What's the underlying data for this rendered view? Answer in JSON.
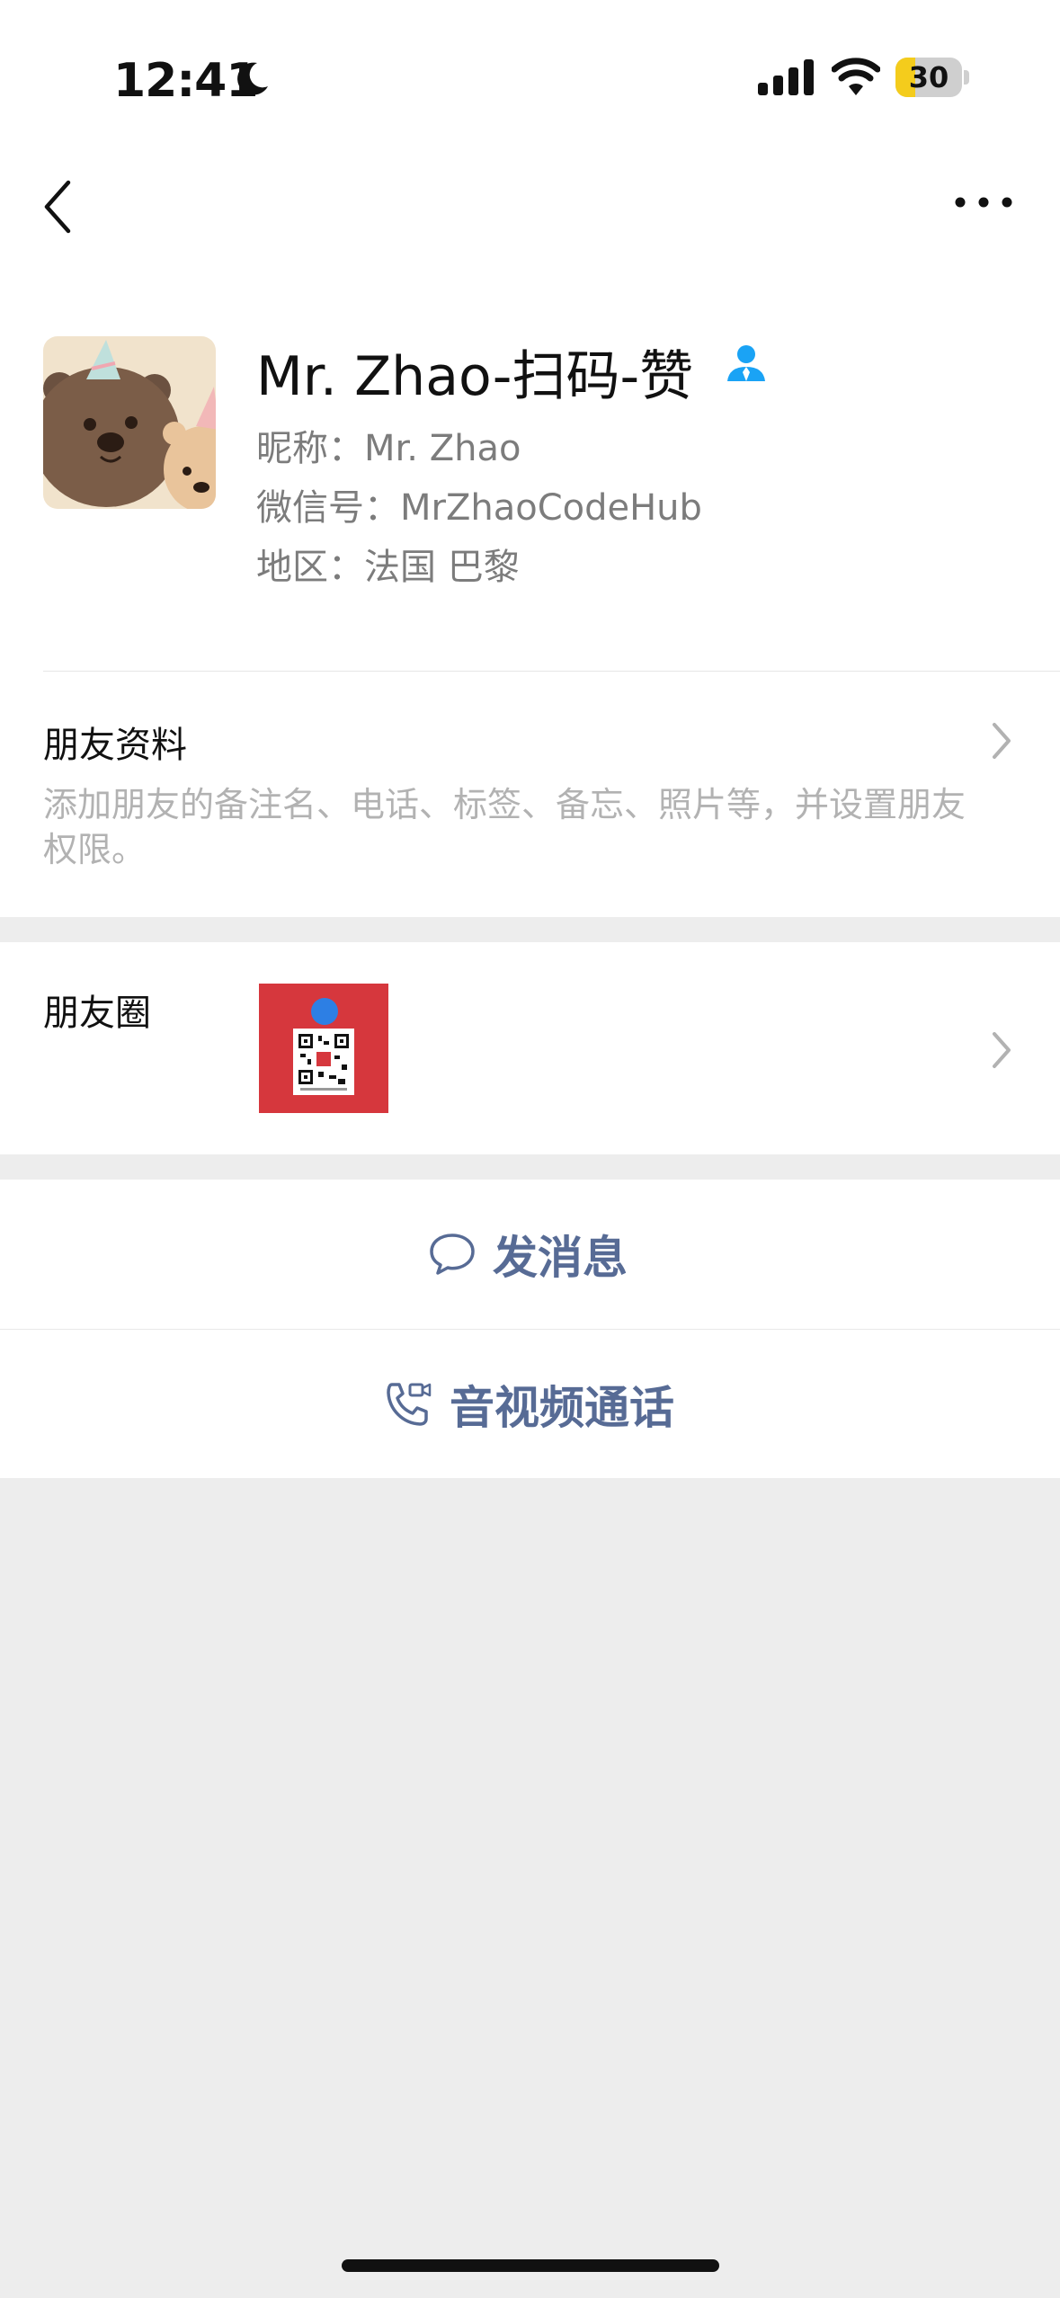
{
  "status_bar": {
    "time": "12:41",
    "battery_level": "30",
    "battery_fraction": 0.3
  },
  "nav": {
    "back_icon": "chevron-left-icon",
    "more_icon": "more-horizontal-icon"
  },
  "profile": {
    "name": "Mr. Zhao-扫码-赞",
    "nickname": "昵称：Mr. Zhao",
    "wechat_id": "微信号：MrZhaoCodeHub",
    "region": "地区：法国 巴黎",
    "accent": "#1aa3f5"
  },
  "friend_info": {
    "title": "朋友资料",
    "description": "添加朋友的备注名、电话、标签、备忘、照片等，并设置朋友权限。"
  },
  "moments": {
    "title": "朋友圈"
  },
  "actions": {
    "send_message": "发消息",
    "call": "音视频通话",
    "link_color": "#576b95"
  }
}
